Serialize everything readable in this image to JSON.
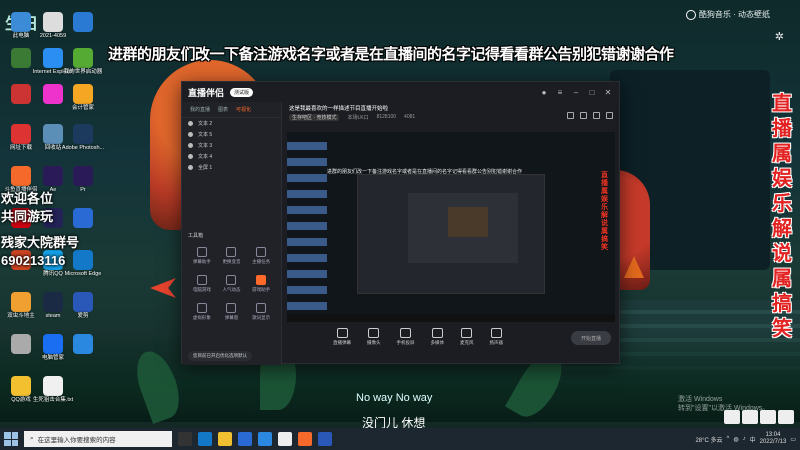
{
  "desktop": {
    "corner_logo": "生田",
    "icons": [
      {
        "label": "此电脑",
        "color": "#3c8bd6"
      },
      {
        "label": "2021-4059",
        "color": "#dddddd"
      },
      {
        "label": "",
        "color": "#2a7ad4"
      },
      {
        "label": "",
        "color": "#3a7a35"
      },
      {
        "label": "Internet Explorer",
        "color": "#2a8ef2"
      },
      {
        "label": "我的世界启动器",
        "color": "#5a3"
      },
      {
        "label": "",
        "color": "#c33"
      },
      {
        "label": "",
        "color": "#e3c"
      },
      {
        "label": "会计管家",
        "color": "#f5a623"
      },
      {
        "label": "网址下载",
        "color": "#d33"
      },
      {
        "label": "回收站",
        "color": "#5c8fb8"
      },
      {
        "label": "Adobe Photosh...",
        "color": "#1c3a5e"
      },
      {
        "label": "斗鱼直播伴侣",
        "color": "#f56a2a"
      },
      {
        "label": "Ae",
        "color": "#2a1a58"
      },
      {
        "label": "Pr",
        "color": "#2a1a58"
      },
      {
        "label": "",
        "color": "#c01"
      },
      {
        "label": "",
        "color": "#225"
      },
      {
        "label": "",
        "color": "#2a6ad4"
      },
      {
        "label": "",
        "color": "#c42"
      },
      {
        "label": "腾讯QQ",
        "color": "#15a0e6"
      },
      {
        "label": "Microsoft Edge",
        "color": "#1478c8"
      },
      {
        "label": "双虫斗地主",
        "color": "#f0a030"
      },
      {
        "label": "steam",
        "color": "#1a2a44"
      },
      {
        "label": "爱剪",
        "color": "#2a58b8"
      },
      {
        "label": "",
        "color": "#aaa"
      },
      {
        "label": "电脑管家",
        "color": "#1a6ef2"
      },
      {
        "label": "",
        "color": "#2a88e0"
      },
      {
        "label": "QQ游戏",
        "color": "#f3c030"
      },
      {
        "label": "生死狙击合集.txt",
        "color": "#f0f0f0"
      }
    ]
  },
  "overlays": {
    "top_banner": "进群的朋友们改一下备注游戏名字或者是在直播间的名字记得看看群公告别犯错谢谢合作",
    "side_banner": "直播属娱乐解说属搞笑",
    "welcome_line1": "欢迎各位",
    "welcome_line2": "共同游玩",
    "group_line1": "残家大院群号",
    "group_line2": "690213116",
    "music_brand": "酷狗音乐 · 动态壁纸",
    "subtitle_en": "No way No way",
    "subtitle_cn": "没门儿 休想",
    "activate_line1": "激活 Windows",
    "activate_line2": "转到\"设置\"以激活 Windows。"
  },
  "app": {
    "title": "直播伴侣",
    "badge": "测试版",
    "left_tabs": [
      "我的直播",
      "图表",
      "可视化"
    ],
    "active_tab": "可视化",
    "scenes": [
      "文本 2",
      "文本 5",
      "文本 3",
      "文本 4",
      "全屏 1"
    ],
    "tools_title": "工具箱",
    "tools": [
      "弹幕助手",
      "更换变音",
      "主播任务",
      "电脑游戏",
      "人气动态",
      "游戏助手",
      "虚拟形象",
      "弹幕窗",
      "歌词显示",
      "",
      "",
      ""
    ],
    "footer_note": "您目前已开启优化选项默认",
    "live_title": "这是我最喜欢的一样描述节目直播开始啦",
    "live_meta": [
      "生存吧区 · 竞技模式",
      "本场LK口",
      "8128100",
      "4081"
    ],
    "controls": [
      "直播弹幕",
      "摄像头",
      "手机投屏",
      "多媒体",
      "麦克风",
      "扬声器"
    ],
    "start_label": "开始直播"
  },
  "taskbar": {
    "search_placeholder": "在这里输入你要搜索的内容",
    "weather": "28°C 多云",
    "ime": "中",
    "time": "13:04",
    "date": "2022/7/13"
  }
}
